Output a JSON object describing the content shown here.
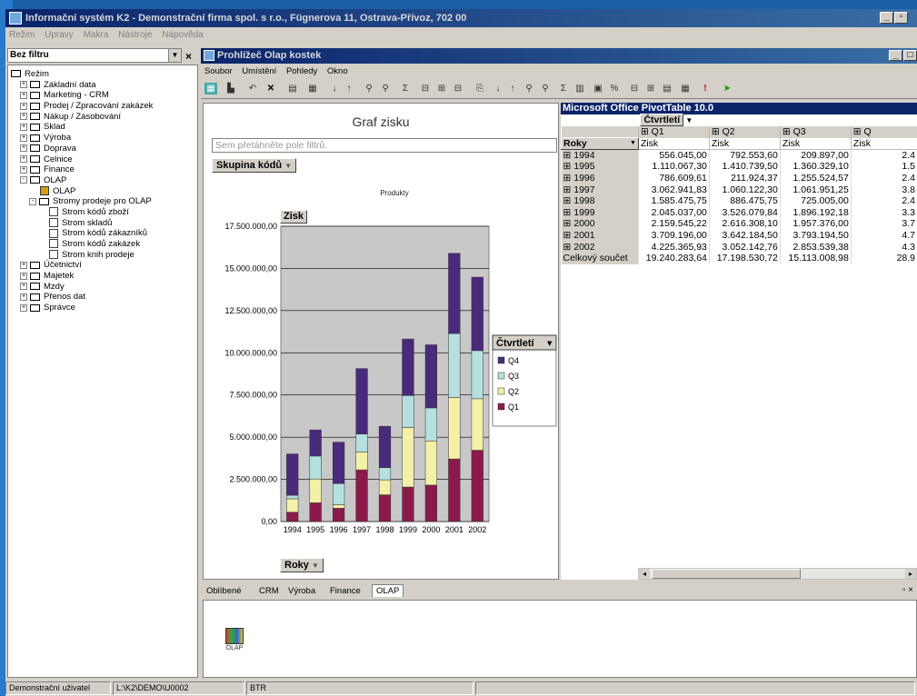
{
  "app": {
    "title": "Informační systém K2 - Demonstrační firma spol. s r.o., Fügnerova 11, Ostrava-Přívoz, 702 00",
    "menu": [
      "Režim",
      "Upravy",
      "Makra",
      "Nástroje",
      "Nápověda"
    ]
  },
  "left": {
    "filter_value": "Bez filtru",
    "tree": [
      {
        "label": "Režim",
        "level": 0,
        "icon": "folder-open-icon",
        "expander": ""
      },
      {
        "label": "Základní data",
        "level": 1,
        "icon": "folder-icon",
        "expander": "+"
      },
      {
        "label": "Marketing - CRM",
        "level": 1,
        "icon": "folder-icon",
        "expander": "+"
      },
      {
        "label": "Prodej / Zpracování zakázek",
        "level": 1,
        "icon": "folder-icon",
        "expander": "+"
      },
      {
        "label": "Nákup / Zásobování",
        "level": 1,
        "icon": "folder-icon",
        "expander": "+"
      },
      {
        "label": "Sklad",
        "level": 1,
        "icon": "folder-icon",
        "expander": "+"
      },
      {
        "label": "Výroba",
        "level": 1,
        "icon": "folder-icon",
        "expander": "+"
      },
      {
        "label": "Doprava",
        "level": 1,
        "icon": "folder-icon",
        "expander": "+"
      },
      {
        "label": "Celnice",
        "level": 1,
        "icon": "folder-icon",
        "expander": "+"
      },
      {
        "label": "Finance",
        "level": 1,
        "icon": "folder-icon",
        "expander": "+"
      },
      {
        "label": "OLAP",
        "level": 1,
        "icon": "folder-open-icon",
        "expander": "-"
      },
      {
        "label": "OLAP",
        "level": 2,
        "icon": "olap-chart-icon",
        "expander": ""
      },
      {
        "label": "Stromy prodeje pro OLAP",
        "level": 2,
        "icon": "folder-open-icon",
        "expander": "-"
      },
      {
        "label": "Strom kódů zboží",
        "level": 3,
        "icon": "document-icon",
        "expander": ""
      },
      {
        "label": "Strom skladů",
        "level": 3,
        "icon": "document-icon",
        "expander": ""
      },
      {
        "label": "Strom kódů zákazníků",
        "level": 3,
        "icon": "document-icon",
        "expander": ""
      },
      {
        "label": "Strom kódů zakázek",
        "level": 3,
        "icon": "document-icon",
        "expander": ""
      },
      {
        "label": "Strom knih prodeje",
        "level": 3,
        "icon": "document-icon",
        "expander": ""
      },
      {
        "label": "Účetnictví",
        "level": 1,
        "icon": "folder-icon",
        "expander": "+"
      },
      {
        "label": "Majetek",
        "level": 1,
        "icon": "folder-icon",
        "expander": "+"
      },
      {
        "label": "Mzdy",
        "level": 1,
        "icon": "folder-icon",
        "expander": "+"
      },
      {
        "label": "Přenos dat",
        "level": 1,
        "icon": "folder-icon",
        "expander": "+"
      },
      {
        "label": "Správce",
        "level": 1,
        "icon": "folder-icon",
        "expander": "+"
      }
    ]
  },
  "olap": {
    "title": "Prohlížeč Olap kostek",
    "menu": [
      "Soubor",
      "Umístění",
      "Pohledy",
      "Okno"
    ]
  },
  "chart_data": {
    "type": "bar",
    "stacked": true,
    "title": "Graf zisku",
    "filter_placeholder": "Sem přetáhněte pole filtrů.",
    "category_field": "Skupina kódů",
    "subtitle": "Produkty",
    "value_field": "Zisk",
    "x_field": "Roky",
    "legend_title": "Čtvrtletí",
    "legend_position": "right",
    "categories": [
      "1994",
      "1995",
      "1996",
      "1997",
      "1998",
      "1999",
      "2000",
      "2001",
      "2002"
    ],
    "series": [
      {
        "name": "Q1",
        "color": "#8b1a4a",
        "values": [
          556045.0,
          1110067.3,
          786609.61,
          3062941.83,
          1585475.75,
          2045037.0,
          2159545.22,
          3709196.0,
          4225365.93
        ]
      },
      {
        "name": "Q2",
        "color": "#f5f0a8",
        "values": [
          792553.6,
          1410739.5,
          211924.37,
          1060122.3,
          886475.75,
          3526079.84,
          2616308.1,
          3642184.5,
          3052142.76
        ]
      },
      {
        "name": "Q3",
        "color": "#b4e0e0",
        "values": [
          209897.0,
          1360329.1,
          1255524.57,
          1061951.25,
          725005.0,
          1896192.18,
          1957376.0,
          3793194.5,
          2853539.38
        ]
      },
      {
        "name": "Q4",
        "color": "#4a2a7a",
        "values": [
          2450000,
          1550000,
          2450000,
          3880000,
          2450000,
          3350000,
          3740000,
          4750000,
          4350000
        ]
      }
    ],
    "ylim": [
      0,
      17500000
    ],
    "yticks": [
      "0,00",
      "2.500.000,00",
      "5.000.000,00",
      "7.500.000,00",
      "10.000.000,00",
      "12.500.000,00",
      "15.000.000,00",
      "17.500.000,00"
    ],
    "grid": true
  },
  "pivot": {
    "title": "Microsoft Office PivotTable 10.0",
    "column_field": "Čtvrtletí",
    "row_field": "Roky",
    "quarters": [
      "Q1",
      "Q2",
      "Q3",
      "Q"
    ],
    "measure": "Zisk",
    "rows": [
      {
        "label": "1994",
        "vals": [
          "556.045,00",
          "792.553,60",
          "209.897,00",
          "2.4"
        ]
      },
      {
        "label": "1995",
        "vals": [
          "1.110.067,30",
          "1.410.739,50",
          "1.360.329,10",
          "1.5"
        ]
      },
      {
        "label": "1996",
        "vals": [
          "786.609,61",
          "211.924,37",
          "1.255.524,57",
          "2.4"
        ]
      },
      {
        "label": "1997",
        "vals": [
          "3.062.941,83",
          "1.060.122,30",
          "1.061.951,25",
          "3.8"
        ]
      },
      {
        "label": "1998",
        "vals": [
          "1.585.475,75",
          "886.475,75",
          "725.005,00",
          "2.4"
        ]
      },
      {
        "label": "1999",
        "vals": [
          "2.045.037,00",
          "3.526.079,84",
          "1.896.192,18",
          "3.3"
        ]
      },
      {
        "label": "2000",
        "vals": [
          "2.159.545,22",
          "2.616.308,10",
          "1.957.376,00",
          "3.7"
        ]
      },
      {
        "label": "2001",
        "vals": [
          "3.709.196,00",
          "3.642.184,50",
          "3.793.194,50",
          "4.7"
        ]
      },
      {
        "label": "2002",
        "vals": [
          "4.225.365,93",
          "3.052.142,76",
          "2.853.539,38",
          "4.3"
        ]
      }
    ],
    "total": {
      "label": "Celkový součet",
      "vals": [
        "19.240.283,64",
        "17.198.530,72",
        "15.113.008,98",
        "28.9"
      ]
    }
  },
  "tabs": [
    "Oblíbené",
    "CRM",
    "Výroba",
    "Finance",
    "OLAP"
  ],
  "bottom_icon_label": "OLAP",
  "status": [
    "Demonstrační uživatel",
    "L:\\K2\\DEMO\\U0002",
    "BTR"
  ]
}
